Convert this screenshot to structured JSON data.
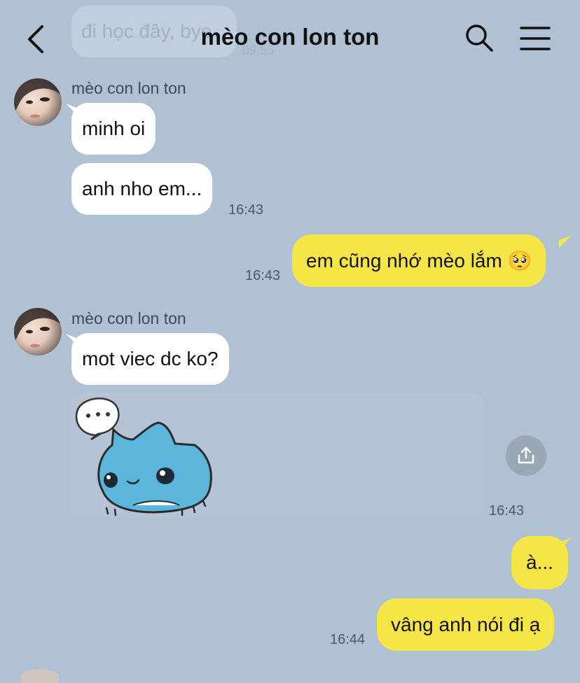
{
  "header": {
    "title": "mèo con lon ton",
    "back_icon": "chevron-left-icon",
    "search_icon": "search-icon",
    "menu_icon": "hamburger-menu-icon"
  },
  "ghost": {
    "text": "đi học đây, bye",
    "time": "09:55"
  },
  "messages": {
    "m1": {
      "sender": "mèo con lon ton",
      "text": "minh oi"
    },
    "m2": {
      "text": "anh nho em...",
      "time": "16:43"
    },
    "m3": {
      "text": "em cũng nhớ mèo lắm 🥺",
      "time": "16:43"
    },
    "m4": {
      "sender": "mèo con lon ton",
      "text": "mot viec dc ko?"
    },
    "m5": {
      "sticker": "blue-cat-thinking-sticker",
      "time": "16:43"
    },
    "m6": {
      "text": "à..."
    },
    "m7": {
      "text": "vâng anh nói đi ạ",
      "time": "16:44"
    }
  },
  "colors": {
    "background": "#b0c1d4",
    "incoming_bubble": "#ffffff",
    "outgoing_bubble": "#f6e547"
  }
}
